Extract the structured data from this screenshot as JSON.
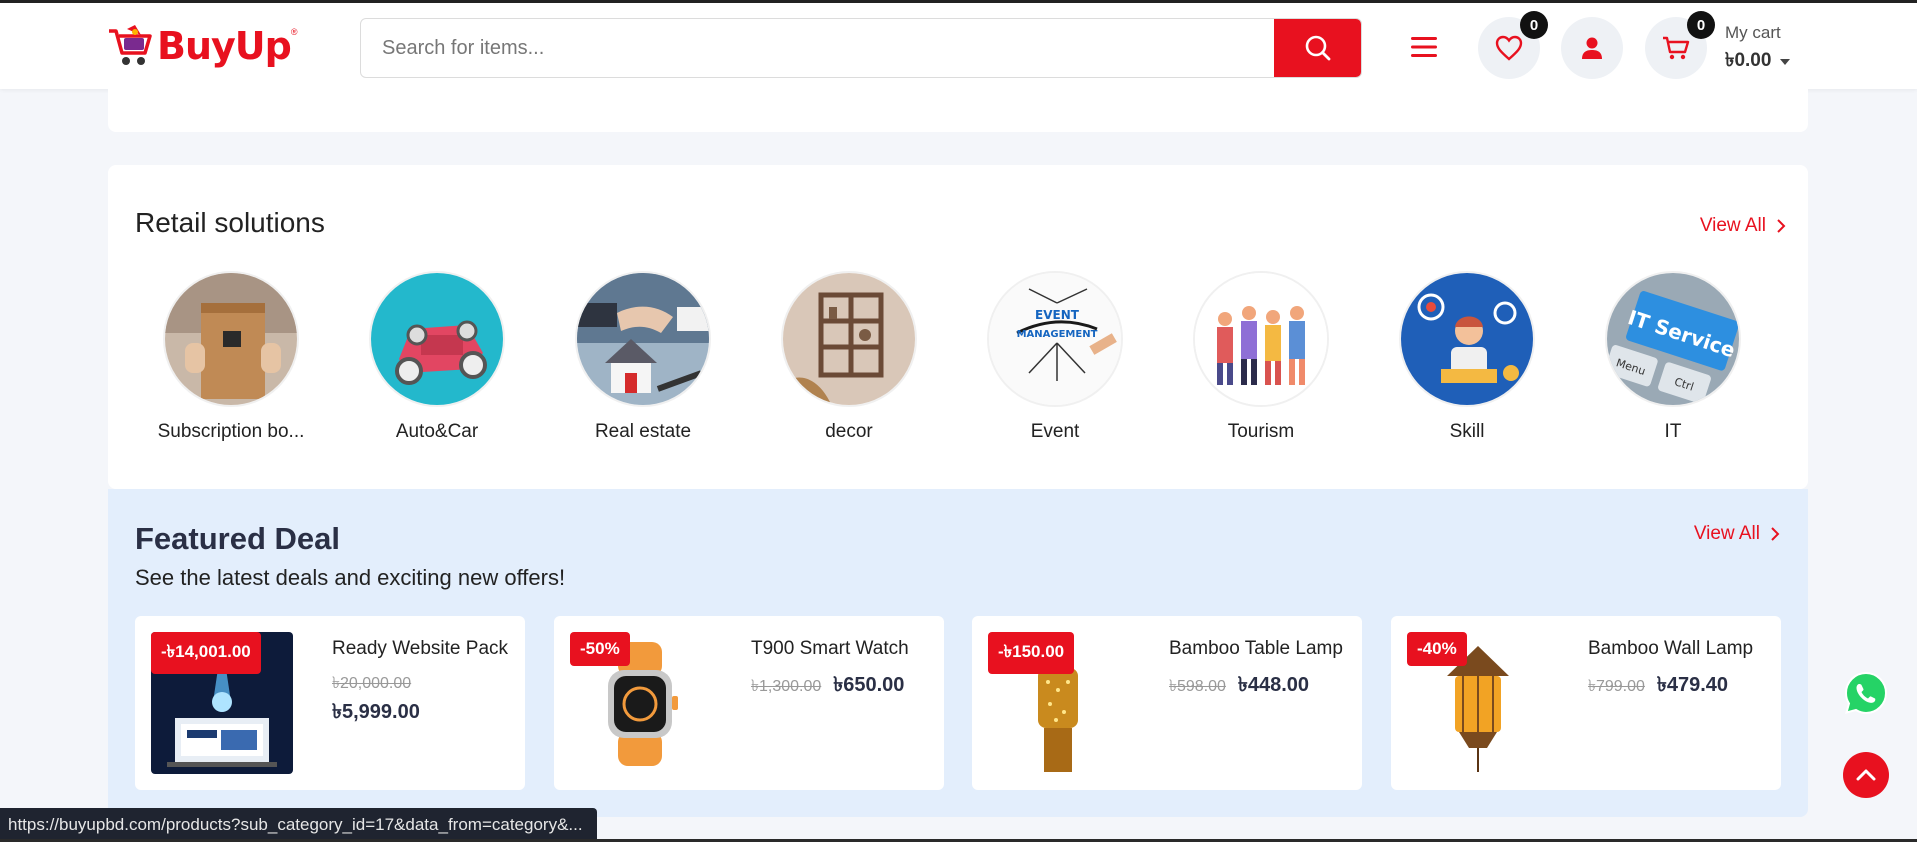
{
  "header": {
    "logo_text": "BuyUp",
    "logo_reg": "®",
    "search_placeholder": "Search for items...",
    "wishlist_count": "0",
    "cart_count": "0",
    "cart_label": "My cart",
    "cart_total": "৳0.00"
  },
  "retail": {
    "title": "Retail solutions",
    "view_all": "View All",
    "categories": [
      {
        "label": "Subscription bo..."
      },
      {
        "label": "Auto&Car"
      },
      {
        "label": "Real estate"
      },
      {
        "label": "decor"
      },
      {
        "label": "Event"
      },
      {
        "label": "Tourism"
      },
      {
        "label": "Skill"
      },
      {
        "label": "IT"
      }
    ]
  },
  "featured": {
    "title": "Featured Deal",
    "subtitle": "See the latest deals and exciting new offers!",
    "view_all": "View All",
    "products": [
      {
        "name": "Ready Website Pack",
        "discount": "-৳14,001.00",
        "old_price": "৳20,000.00",
        "price": "৳5,999.00"
      },
      {
        "name": "T900 Smart Watch",
        "discount": "-50%",
        "old_price": "৳1,300.00",
        "price": "৳650.00"
      },
      {
        "name": "Bamboo Table Lamp",
        "discount": "-৳150.00",
        "old_price": "৳598.00",
        "price": "৳448.00"
      },
      {
        "name": "Bamboo Wall Lamp",
        "discount": "-40%",
        "old_price": "৳799.00",
        "price": "৳479.40"
      }
    ]
  },
  "status_url": "https://buyupbd.com/products?sub_category_id=17&data_from=category&...",
  "colors": {
    "brand": "#e8111f",
    "featured_bg": "#e3eefc"
  }
}
